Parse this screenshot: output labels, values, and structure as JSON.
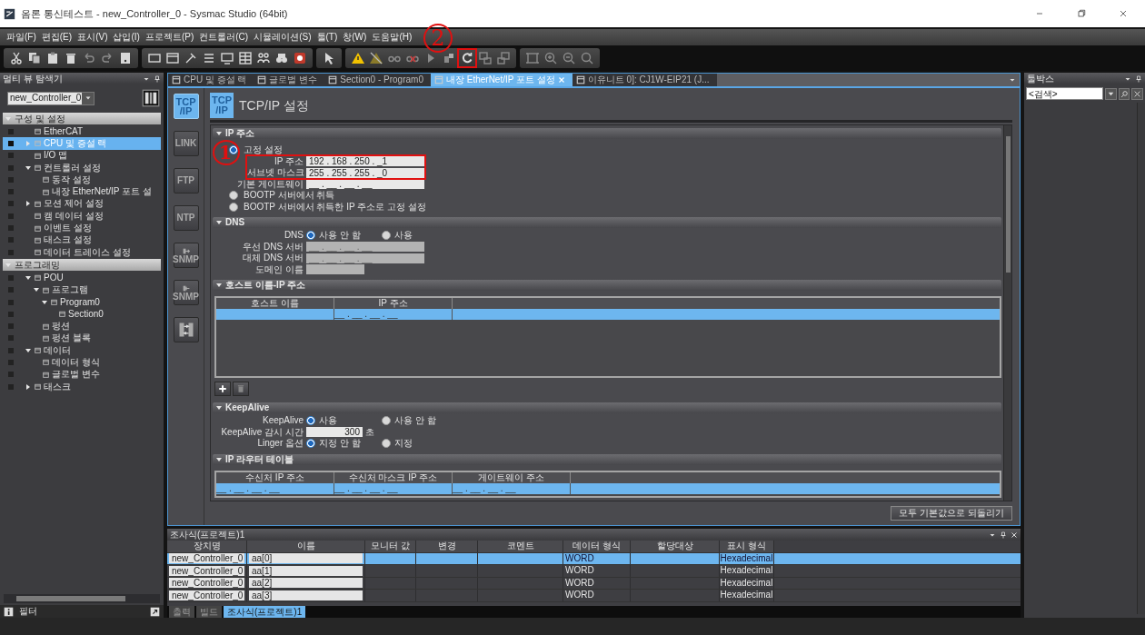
{
  "window": {
    "title": "옴론 통신테스트 - new_Controller_0 - Sysmac Studio (64bit)"
  },
  "menu": [
    "파일(F)",
    "편집(E)",
    "표시(V)",
    "삽입(I)",
    "프로젝트(P)",
    "컨트롤러(C)",
    "시뮬레이션(S)",
    "툴(T)",
    "창(W)",
    "도움말(H)"
  ],
  "annotations": {
    "toolbar_marker": "2",
    "ip_marker": "1"
  },
  "explorer": {
    "title": "멀티 뷰 탐색기",
    "controller": "new_Controller_0",
    "filter_label": "필터",
    "sections": [
      {
        "title": "구성 및 설정",
        "expanded": true,
        "items": [
          {
            "label": "EtherCAT",
            "selected": false
          },
          {
            "label": "CPU 및 증설 랙",
            "selected": true,
            "expanded": false
          },
          {
            "label": "I/O 맵",
            "selected": false
          },
          {
            "label": "컨트롤러 설정",
            "selected": false,
            "expanded": true,
            "children": [
              {
                "label": "동작 설정",
                "selected": false
              },
              {
                "label": "내장 EtherNet/IP 포트 설",
                "selected": false
              }
            ]
          },
          {
            "label": "모션 제어 설정",
            "selected": false,
            "expanded": false
          },
          {
            "label": "캠 데이터 설정",
            "selected": false
          },
          {
            "label": "이벤트 설정",
            "selected": false
          },
          {
            "label": "태스크 설정",
            "selected": false
          },
          {
            "label": "데이터 트레이스 설정",
            "selected": false
          }
        ]
      },
      {
        "title": "프로그래밍",
        "expanded": true,
        "items": [
          {
            "label": "POU",
            "selected": false,
            "expanded": true,
            "children": [
              {
                "label": "프로그램",
                "selected": false,
                "expanded": true,
                "children": [
                  {
                    "label": "Program0",
                    "selected": false,
                    "expanded": true,
                    "children": [
                      {
                        "label": "Section0",
                        "selected": false
                      }
                    ]
                  }
                ]
              },
              {
                "label": "펑션",
                "selected": false
              },
              {
                "label": "펑션 블록",
                "selected": false
              }
            ]
          },
          {
            "label": "데이터",
            "selected": false,
            "expanded": true,
            "children": [
              {
                "label": "데이터 형식",
                "selected": false
              },
              {
                "label": "글로벌 변수",
                "selected": false
              }
            ]
          },
          {
            "label": "태스크",
            "selected": false,
            "expanded": false
          }
        ]
      }
    ]
  },
  "editor_tabs": [
    {
      "label": "CPU 및 증설 랙",
      "selected": false
    },
    {
      "label": "글로벌 변수",
      "selected": false
    },
    {
      "label": "Section0 - Program0",
      "selected": false
    },
    {
      "label": "내장 EtherNet/IP 포트 설정",
      "selected": true
    },
    {
      "label": "이유니트 0]: CJ1W-EIP21 (J...",
      "selected": false
    }
  ],
  "settings": {
    "side_buttons": [
      {
        "kind": "text",
        "lines": [
          "TCP",
          "/IP"
        ],
        "selected": true
      },
      {
        "kind": "text",
        "lines": [
          "LINK"
        ],
        "selected": false
      },
      {
        "kind": "text",
        "lines": [
          "FTP"
        ],
        "selected": false
      },
      {
        "kind": "text",
        "lines": [
          "NTP"
        ],
        "selected": false
      },
      {
        "kind": "snmp_out",
        "lines": [
          "SNMP"
        ],
        "selected": false
      },
      {
        "kind": "snmp_in",
        "lines": [
          "SNMP"
        ],
        "selected": false
      },
      {
        "kind": "icon",
        "selected": false
      }
    ],
    "heading": {
      "badge_lines": [
        "TCP",
        "/IP"
      ],
      "title": "TCP/IP 설정"
    },
    "sections": [
      {
        "title": "IP 주소",
        "expanded": true,
        "rows": [
          {
            "kind": "radio",
            "label": "고정 설정",
            "selected": true
          },
          {
            "kind": "ip_field",
            "label": "IP 주소",
            "value": "192 . 168 . 250 . _1",
            "disabled": false,
            "highlighted": true
          },
          {
            "kind": "ip_field",
            "label": "서브넷 마스크",
            "value": "255 . 255 . 255 . _0",
            "disabled": false,
            "highlighted": true
          },
          {
            "kind": "ip_field",
            "label": "기본 게이트웨이",
            "value": "__ . __ . __ . __",
            "disabled": false,
            "highlighted": false
          },
          {
            "kind": "radio",
            "label": "BOOTP 서버에서 취득",
            "selected": false
          },
          {
            "kind": "radio",
            "label": "BOOTP 서버에서 취득한 IP 주소로 고정 설정",
            "selected": false
          }
        ]
      },
      {
        "title": "DNS",
        "expanded": true,
        "rows": [
          {
            "kind": "choice",
            "label": "DNS",
            "options": [
              {
                "label": "사용 안 함",
                "selected": true
              },
              {
                "label": "사용",
                "selected": false
              }
            ]
          },
          {
            "kind": "ip_field",
            "label": "우선 DNS 서버",
            "value": "__ . __ . __ . __",
            "disabled": true,
            "highlighted": false
          },
          {
            "kind": "ip_field",
            "label": "대체 DNS 서버",
            "value": "__ . __ . __ . __",
            "disabled": true,
            "highlighted": false
          },
          {
            "kind": "text_field",
            "label": "도메인 이름",
            "disabled": true,
            "highlighted": false
          }
        ]
      },
      {
        "title": "호스트 이름-IP 주소",
        "expanded": true,
        "rows": [
          {
            "kind": "table",
            "columns": [
              "호스트 이름",
              "IP 주소"
            ],
            "rows": [
              {
                "cells": [
                  null,
                  "__ . __ . __ . __"
                ],
                "selected": true
              }
            ],
            "tools": [
              {
                "kind": "add"
              },
              {
                "kind": "delete"
              }
            ]
          }
        ]
      },
      {
        "title": "KeepAlive",
        "expanded": true,
        "rows": [
          {
            "kind": "choice",
            "label": "KeepAlive",
            "options": [
              {
                "label": "사용",
                "selected": true
              },
              {
                "label": "사용 안 함",
                "selected": false
              }
            ]
          },
          {
            "kind": "number_field",
            "label": "KeepAlive 감시 시간",
            "value": "300",
            "unit": "초",
            "disabled": false
          },
          {
            "kind": "choice",
            "label": "Linger 옵션",
            "options": [
              {
                "label": "지정 안 함",
                "selected": true
              },
              {
                "label": "지정",
                "selected": false
              }
            ]
          }
        ]
      },
      {
        "title": "IP 라우터 테이블",
        "expanded": true,
        "rows": [
          {
            "kind": "table",
            "columns": [
              "수신처 IP 주소",
              "수신처 마스크 IP 주소",
              "게이트웨이 주소"
            ],
            "rows": [
              {
                "cells": [
                  "__ . __ . __ . __",
                  "__ . __ . __ . __",
                  "__ . __ . __ . __"
                ],
                "selected": true
              }
            ]
          }
        ]
      }
    ],
    "reset_button": "모두 기본값으로 되돌리기"
  },
  "watch": {
    "title": "조사식(프로젝트)1",
    "columns": [
      "장치명",
      "이름",
      "모니터 값",
      "변경",
      "코멘트",
      "데이터 형식",
      "할당대상",
      "표시 형식"
    ],
    "rows": [
      {
        "cells": [
          "new_Controller_0",
          "aa[0]",
          null,
          null,
          null,
          "WORD",
          null,
          "Hexadecimal"
        ],
        "selected": true
      },
      {
        "cells": [
          "new_Controller_0",
          "aa[1]",
          null,
          null,
          null,
          "WORD",
          null,
          "Hexadecimal"
        ],
        "selected": false
      },
      {
        "cells": [
          "new_Controller_0",
          "aa[2]",
          null,
          null,
          null,
          "WORD",
          null,
          "Hexadecimal"
        ],
        "selected": false
      },
      {
        "cells": [
          "new_Controller_0",
          "aa[3]",
          null,
          null,
          null,
          "WORD",
          null,
          "Hexadecimal"
        ],
        "selected": false
      }
    ]
  },
  "bottom_tabs": [
    {
      "label": "출력",
      "selected": false
    },
    {
      "label": "빌드",
      "selected": false
    },
    {
      "label": "조사식(프로젝트)1",
      "selected": true
    }
  ],
  "toolbox": {
    "title": "툴박스",
    "search_value": "<검색>"
  }
}
